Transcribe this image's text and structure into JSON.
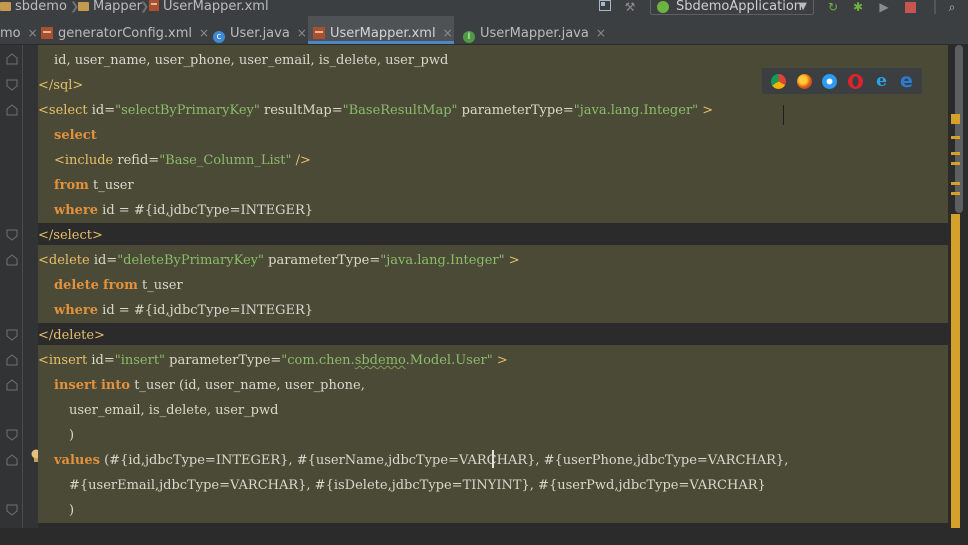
{
  "navbar": {
    "crumbs": [
      "sbdemo",
      "Mapper",
      "UserMapper.xml"
    ],
    "run_config": "SbdemoApplication",
    "icons": [
      "folder-icon",
      "xml-file-icon",
      "build-hammer-icon",
      "spring-boot-icon",
      "run-icon",
      "debug-icon",
      "coverage-icon",
      "stop-icon",
      "search-icon"
    ]
  },
  "tabs": [
    {
      "label": "mo",
      "icon": "none"
    },
    {
      "label": "generatorConfig.xml",
      "icon": "xml-file-icon"
    },
    {
      "label": "User.java",
      "icon": "class-icon"
    },
    {
      "label": "UserMapper.xml",
      "icon": "xml-file-icon",
      "active": true
    },
    {
      "label": "UserMapper.java",
      "icon": "interface-icon"
    }
  ],
  "tab_close": "×",
  "browsers": [
    "chrome-icon",
    "firefox-icon",
    "safari-icon",
    "opera-icon",
    "ie-icon",
    "edge-icon"
  ],
  "code": {
    "l1": {
      "t": "id, user_name, user_phone, user_email, is_delete, user_pwd"
    },
    "l2": {
      "a": "</sql>"
    },
    "l3": {
      "a": "<select ",
      "b": "id=",
      "c": "\"selectByPrimaryKey\"",
      "d": " resultMap=",
      "e": "\"BaseResultMap\"",
      "f": " parameterType=",
      "g": "\"java.lang.Integer\"",
      "h": " >"
    },
    "l4": {
      "a": "select"
    },
    "l5": {
      "a": "<include ",
      "b": "refid=",
      "c": "\"Base_Column_List\"",
      "d": " />"
    },
    "l6": {
      "a": "from",
      "b": " t_user"
    },
    "l7": {
      "a": "where",
      "b": " id = #{id,jdbcType=INTEGER}"
    },
    "l8": {
      "a": "</select>"
    },
    "l9": {
      "a": "<delete ",
      "b": "id=",
      "c": "\"deleteByPrimaryKey\"",
      "d": " parameterType=",
      "e": "\"java.lang.Integer\"",
      "f": " >"
    },
    "l10": {
      "a": "delete",
      "b": " ",
      "c": "from",
      "d": " t_user"
    },
    "l11": {
      "a": "where",
      "b": " id = #{id,jdbcType=INTEGER}"
    },
    "l12": {
      "a": "</delete>"
    },
    "l13": {
      "a": "<insert ",
      "b": "id=",
      "c": "\"insert\"",
      "d": " parameterType=",
      "e": "\"com.chen.",
      "f": "sbdemo",
      "g": ".Model.User\"",
      "h": " >"
    },
    "l14": {
      "a": "insert",
      "b": " ",
      "c": "into",
      "d": " t_user (id, user_name, user_phone,"
    },
    "l15": {
      "t": "user_email, is_delete, user_pwd"
    },
    "l16": {
      "t": ")"
    },
    "l17": {
      "a": "values",
      "b": " (#{id,jdbcType=INTEGER}, #{userName,jdbcType=VARCHAR}, #{userPhone,jdbcType=VARCHAR},"
    },
    "l18": {
      "t": "#{userEmail,jdbcType=VARCHAR}, #{isDelete,jdbcType=TINYINT}, #{userPwd,jdbcType=VARCHAR}"
    },
    "l19": {
      "t": ")"
    }
  }
}
